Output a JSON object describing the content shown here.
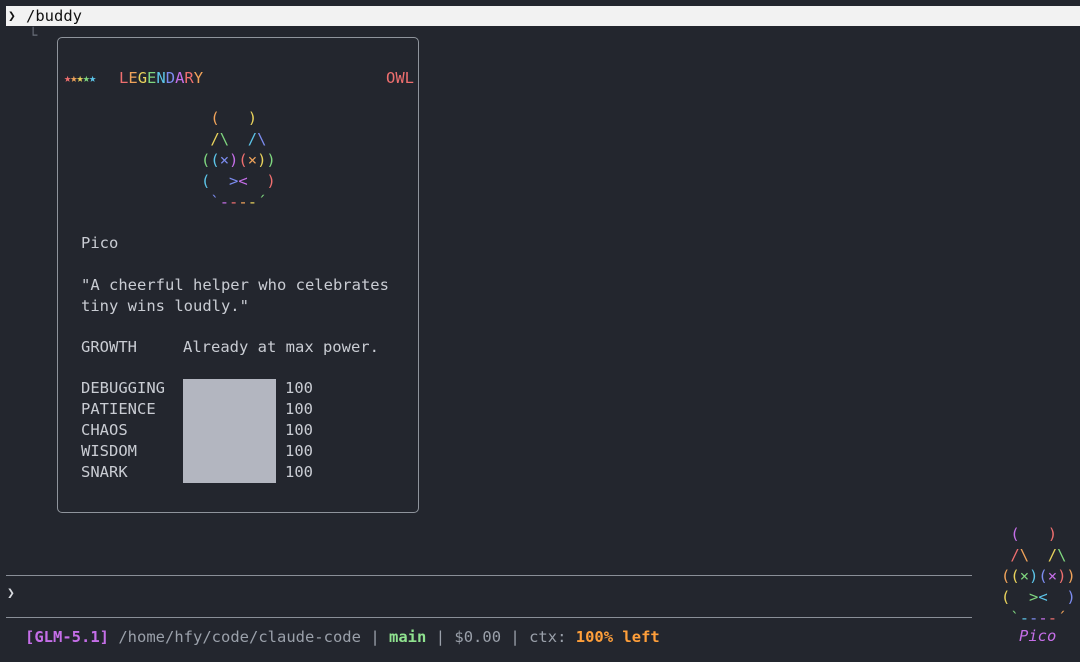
{
  "command_bar": {
    "prompt": "❯",
    "command": "/buddy"
  },
  "tree_connector": "└",
  "card": {
    "stars": "★★★★★",
    "rarity": "LEGENDARY",
    "species": "OWL",
    "art_lines": [
      "(   )",
      "/\\  /\\",
      "((×)(×))",
      "(  ><  )",
      "`----´"
    ],
    "name": "Pico",
    "quote_line1": "\"A cheerful helper who celebrates",
    "quote_line2": "tiny wins loudly.\"",
    "growth_label": "GROWTH",
    "growth_value": "Already at max power.",
    "stats": [
      {
        "name": "DEBUGGING",
        "value": "100",
        "fill_fraction": 1.0
      },
      {
        "name": "PATIENCE",
        "value": "100",
        "fill_fraction": 1.0
      },
      {
        "name": "CHAOS",
        "value": "100",
        "fill_fraction": 1.0
      },
      {
        "name": "WISDOM",
        "value": "100",
        "fill_fraction": 1.0
      },
      {
        "name": "SNARK",
        "value": "100",
        "fill_fraction": 1.0
      }
    ]
  },
  "input": {
    "prompt": "❯"
  },
  "status": {
    "model": "[GLM-5.1]",
    "path": "/home/hfy/code/claude-code",
    "separator": "|",
    "branch": "main",
    "cost": "$0.00",
    "ctx_label": "ctx:",
    "ctx_value": "100% left"
  },
  "mini_buddy": {
    "art_lines": [
      "(   )",
      "/\\  /\\",
      "((×)(×))",
      "(  ><  )",
      "`----´"
    ],
    "name": "Pico"
  },
  "colors": {
    "background": "#23262e",
    "rainbow": [
      "#ef6f6f",
      "#f0a35a",
      "#e8d25c",
      "#7fd67f",
      "#5cc4e8",
      "#7c8cf0",
      "#c56ee8"
    ],
    "model": "#c56ee8",
    "branch": "#8fe28f",
    "ctx": "#ff9f3a",
    "bar": "#b3b6c0"
  }
}
